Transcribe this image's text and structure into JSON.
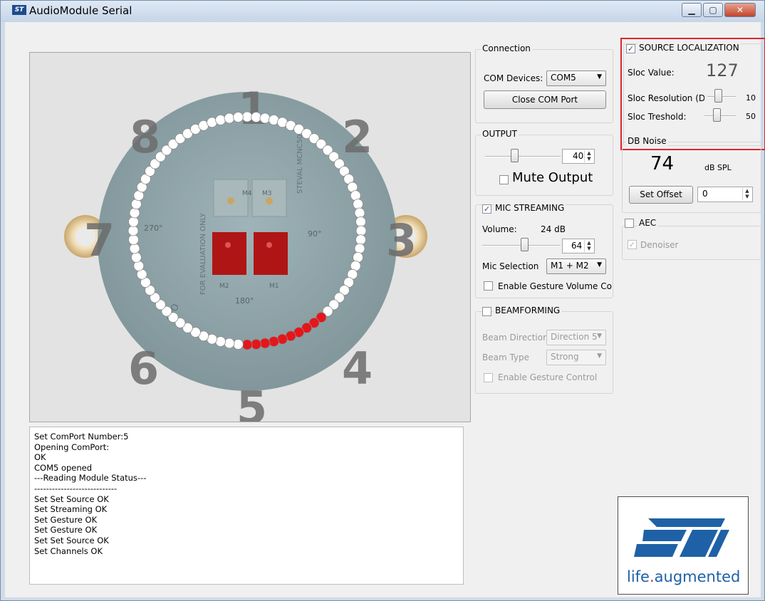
{
  "window": {
    "title": "AudioModule Serial",
    "icon": "st-icon",
    "minimize": "▁",
    "maximize": "▢",
    "close": "✕"
  },
  "display": {
    "numbers": [
      "1",
      "2",
      "3",
      "4",
      "5",
      "6",
      "7",
      "8"
    ],
    "board_labels": {
      "m1": "M1",
      "m2": "M2",
      "m3": "M3",
      "m4": "M4",
      "deg270": "270°",
      "deg180": "180°",
      "deg90": "90°",
      "eval": "FOR EVALUATION ONLY",
      "part": "STEVAL MCNC50",
      "rev": "AVO"
    },
    "led_count": 80,
    "active_leds": [
      31,
      32,
      33,
      34,
      35,
      36,
      37,
      38,
      39,
      40
    ],
    "led_on_color": "#e4161b",
    "led_off_color": "#ffffff"
  },
  "console": {
    "lines": [
      "Set ComPort Number:5",
      "Opening ComPort:",
      "OK",
      "COM5 opened",
      "---Reading Module Status---",
      "----------------------------",
      "Set Set Source OK",
      "Set Streaming OK",
      "Set Gesture OK",
      "Set Gesture OK",
      "Set Set Source OK",
      "Set Channels OK"
    ]
  },
  "connection": {
    "title": "Connection",
    "devices_label": "COM Devices:",
    "device_value": "COM5",
    "close_button": "Close COM Port"
  },
  "output": {
    "title": "OUTPUT",
    "level": 40,
    "level_value": "40",
    "mute_label": "Mute Output",
    "mute_checked": false
  },
  "mic_streaming": {
    "title": "MIC STREAMING",
    "checked": true,
    "volume_label": "Volume:",
    "volume_db": "24 dB",
    "volume_value": "64",
    "mic_selection_label": "Mic Selection",
    "mic_selection_value": "M1 + M2",
    "gesture_label": "Enable Gesture Volume Co",
    "gesture_checked": false
  },
  "beamforming": {
    "title": "BEAMFORMING",
    "checked": false,
    "direction_label": "Beam Directior",
    "direction_value": "Direction 5",
    "type_label": "Beam Type",
    "type_value": "Strong",
    "gesture_label": "Enable Gesture Control"
  },
  "source_localization": {
    "title": "SOURCE LOCALIZATION",
    "checked": true,
    "sloc_value_label": "Sloc Value:",
    "sloc_value": "127",
    "resolution_label": "Sloc Resolution (D",
    "resolution_value": "10",
    "threshold_label": "Sloc Treshold:",
    "threshold_value": "50"
  },
  "db_noise": {
    "title": "DB Noise",
    "value": "74",
    "unit": "dB SPL",
    "set_offset_button": "Set Offset",
    "offset_value": "0"
  },
  "aec": {
    "title": "AEC",
    "checked": false,
    "denoiser_label": "Denoiser",
    "denoiser_checked": true
  },
  "logo": {
    "tagline_left": "life",
    "tagline_dot": ".",
    "tagline_right": "augmented"
  },
  "colors": {
    "accent": "#e0262d",
    "st_blue": "#1f61a6",
    "highlight": "#e0262d"
  }
}
